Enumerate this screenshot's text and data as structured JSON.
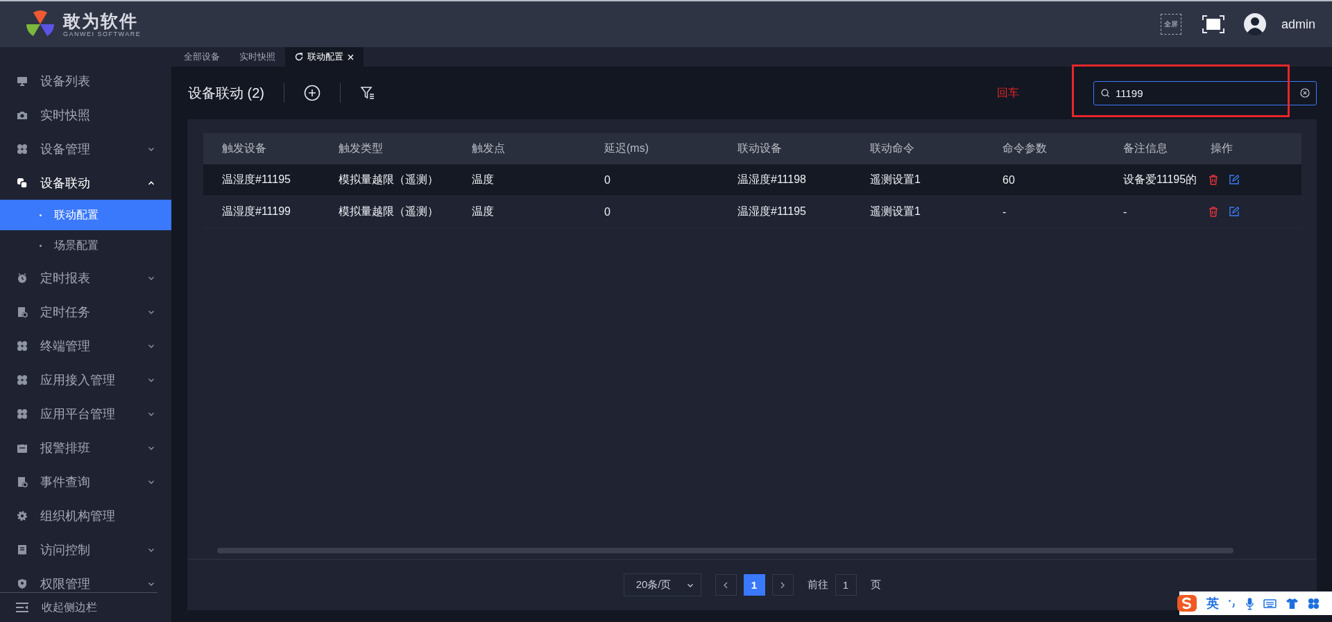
{
  "header": {
    "logo_title": "敢为软件",
    "logo_subtitle": "GANWEI SOFTWARE",
    "fullscreen_label": "全屏",
    "user": "admin"
  },
  "sidebar": {
    "items": [
      {
        "label": "设备列表",
        "expandable": false,
        "expanded": false
      },
      {
        "label": "实时快照",
        "expandable": false,
        "expanded": false
      },
      {
        "label": "设备管理",
        "expandable": true,
        "expanded": false
      },
      {
        "label": "设备联动",
        "expandable": true,
        "expanded": true,
        "children": [
          {
            "label": "联动配置",
            "selected": true
          },
          {
            "label": "场景配置",
            "selected": false
          }
        ]
      },
      {
        "label": "定时报表",
        "expandable": true,
        "expanded": false
      },
      {
        "label": "定时任务",
        "expandable": true,
        "expanded": false
      },
      {
        "label": "终端管理",
        "expandable": true,
        "expanded": false
      },
      {
        "label": "应用接入管理",
        "expandable": true,
        "expanded": false
      },
      {
        "label": "应用平台管理",
        "expandable": true,
        "expanded": false
      },
      {
        "label": "报警排班",
        "expandable": true,
        "expanded": false
      },
      {
        "label": "事件查询",
        "expandable": true,
        "expanded": false
      },
      {
        "label": "组织机构管理",
        "expandable": false,
        "expanded": false
      },
      {
        "label": "访问控制",
        "expandable": true,
        "expanded": false
      },
      {
        "label": "权限管理",
        "expandable": true,
        "expanded": false
      }
    ],
    "collapse_label": "收起侧边栏"
  },
  "tabs": [
    {
      "label": "全部设备",
      "selected": false,
      "closable": false,
      "refresh": false
    },
    {
      "label": "实时快照",
      "selected": false,
      "closable": false,
      "refresh": false
    },
    {
      "label": "联动配置",
      "selected": true,
      "closable": true,
      "refresh": true
    }
  ],
  "toolbar": {
    "title": "设备联动 (2)"
  },
  "annotation": {
    "label": "回车"
  },
  "search": {
    "value": "11199"
  },
  "table": {
    "columns": [
      "触发设备",
      "触发类型",
      "触发点",
      "延迟(ms)",
      "联动设备",
      "联动命令",
      "命令参数",
      "备注信息",
      "操作"
    ],
    "rows": [
      {
        "hovered": true,
        "cells": [
          "温湿度#11195",
          "模拟量越限（遥测）",
          "温度",
          "0",
          "温湿度#11198",
          "遥测设置1",
          "60",
          "设备爱11195的"
        ]
      },
      {
        "hovered": false,
        "cells": [
          "温湿度#11199",
          "模拟量越限（遥测）",
          "温度",
          "0",
          "温湿度#11195",
          "遥测设置1",
          "-",
          "-"
        ]
      }
    ]
  },
  "pagination": {
    "page_size": "20条/页",
    "pages": [
      {
        "label": "1",
        "selected": true
      }
    ],
    "goto_label": "前往",
    "goto_value": "1",
    "page_suffix": "页"
  },
  "ime_toolbar": {
    "mode": "英"
  }
}
